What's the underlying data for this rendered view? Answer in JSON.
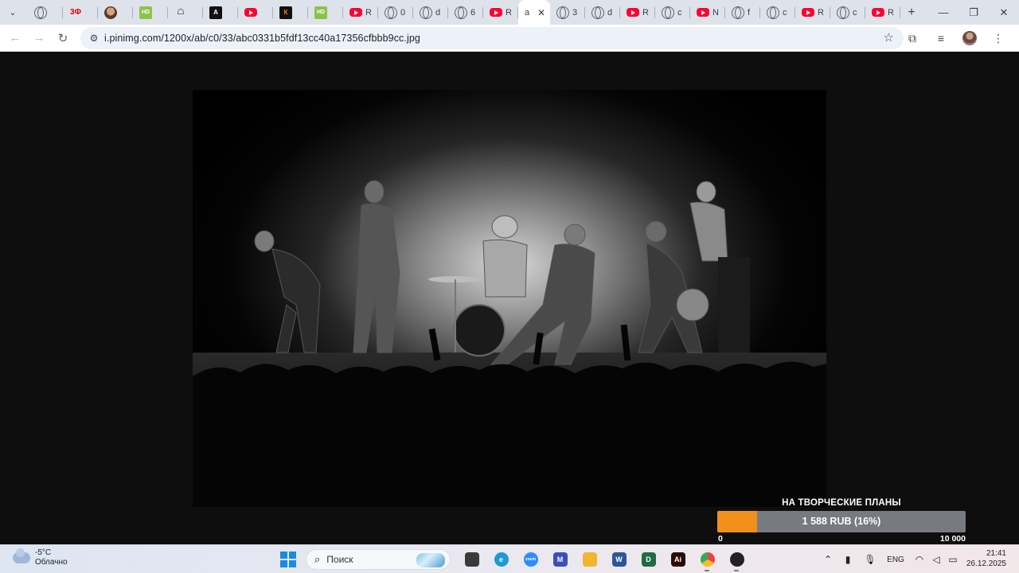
{
  "browser": {
    "tabs": [
      {
        "favicon": "globe-icon",
        "label": ""
      },
      {
        "favicon": "3d-logo-icon",
        "label": ""
      },
      {
        "favicon": "face-avatar-icon",
        "label": ""
      },
      {
        "favicon": "hd-badge-icon",
        "label": ""
      },
      {
        "favicon": "movie-logo-icon",
        "label": ""
      },
      {
        "favicon": "a-logo-icon",
        "label": ""
      },
      {
        "favicon": "youtube-icon",
        "label": ""
      },
      {
        "favicon": "kc-logo-icon",
        "label": ""
      },
      {
        "favicon": "hd-badge-icon",
        "label": ""
      },
      {
        "favicon": "youtube-icon",
        "label": "R"
      },
      {
        "favicon": "globe-icon",
        "label": "0"
      },
      {
        "favicon": "globe-icon",
        "label": "d"
      },
      {
        "favicon": "globe-icon",
        "label": "6"
      },
      {
        "favicon": "youtube-icon",
        "label": "R"
      },
      {
        "favicon": "none",
        "label": "a",
        "active": true
      },
      {
        "favicon": "globe-icon",
        "label": "3"
      },
      {
        "favicon": "globe-icon",
        "label": "d"
      },
      {
        "favicon": "youtube-icon",
        "label": "R"
      },
      {
        "favicon": "globe-icon",
        "label": "c"
      },
      {
        "favicon": "youtube-icon",
        "label": "N"
      },
      {
        "favicon": "globe-icon",
        "label": "f"
      },
      {
        "favicon": "globe-icon",
        "label": "c"
      },
      {
        "favicon": "youtube-icon",
        "label": "R"
      },
      {
        "favicon": "globe-icon",
        "label": "c"
      },
      {
        "favicon": "youtube-icon",
        "label": "R"
      }
    ],
    "url": "i.pinimg.com/1200x/ab/c0/33/abc0331b5fdf13cc40a17356cfbbb9cc.jpg"
  },
  "donation": {
    "title": "НА ТВОРЧЕСКИЕ ПЛАНЫ",
    "amount_text": "1 588 RUB (16%)",
    "progress_fraction": 0.16,
    "min_label": "0",
    "max_label": "10 000",
    "fill_color": "#f0901a"
  },
  "taskbar": {
    "weather_temp": "-5°C",
    "weather_desc": "Облачно",
    "search_placeholder": "Поиск",
    "apps": [
      {
        "name": "file-explorer-icon",
        "color": "#3a3a3a",
        "glyph": ""
      },
      {
        "name": "edge-icon",
        "color": "#1c9ad6",
        "glyph": "e"
      },
      {
        "name": "zoom-icon",
        "color": "#2d8cff",
        "glyph": "zoom"
      },
      {
        "name": "monitor-app-icon",
        "color": "#3b4fb8",
        "glyph": "M"
      },
      {
        "name": "folder-icon",
        "color": "#f2b530",
        "glyph": ""
      },
      {
        "name": "word-icon",
        "color": "#2b579a",
        "glyph": "W"
      },
      {
        "name": "davinci-icon",
        "color": "#1f6b43",
        "glyph": "D"
      },
      {
        "name": "illustrator-icon",
        "color": "#2b0a00",
        "glyph": "Ai"
      },
      {
        "name": "chrome-icon",
        "color": "#e8453c",
        "glyph": ""
      },
      {
        "name": "obs-icon",
        "color": "#222222",
        "glyph": ""
      }
    ],
    "language": "ENG",
    "time": "21:41",
    "date": "26.12.2025"
  }
}
